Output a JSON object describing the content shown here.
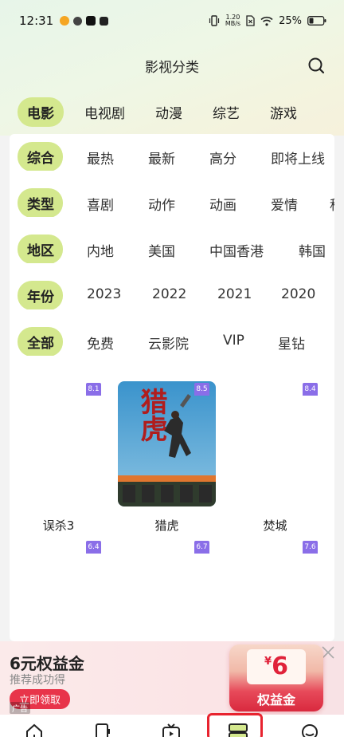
{
  "status_bar": {
    "time": "12:31",
    "net_speed_top": "1.20",
    "net_speed_bottom": "MB/s",
    "battery": "25%"
  },
  "header": {
    "title": "影视分类"
  },
  "main_tabs": [
    "电影",
    "电视剧",
    "动漫",
    "综艺",
    "游戏"
  ],
  "filters": [
    {
      "lead": "综合",
      "options": [
        "最热",
        "最新",
        "高分",
        "即将上线"
      ]
    },
    {
      "lead": "类型",
      "options": [
        "喜剧",
        "动作",
        "动画",
        "爱情",
        "科"
      ]
    },
    {
      "lead": "地区",
      "options": [
        "内地",
        "美国",
        "中国香港",
        "韩国"
      ]
    },
    {
      "lead": "年份",
      "options": [
        "2023",
        "2022",
        "2021",
        "2020"
      ]
    },
    {
      "lead": "全部",
      "options": [
        "免费",
        "云影院",
        "VIP",
        "星钻"
      ]
    }
  ],
  "movies": [
    {
      "title": "误杀3",
      "rating": "8.1"
    },
    {
      "title": "猎虎",
      "rating": "8.5",
      "poster_text": "猎虎"
    },
    {
      "title": "焚城",
      "rating": "8.4"
    },
    {
      "title": "",
      "rating": "6.4"
    },
    {
      "title": "",
      "rating": "6.7"
    },
    {
      "title": "",
      "rating": "7.6"
    }
  ],
  "ad": {
    "title": "6元权益金",
    "subtitle": "推荐成功得",
    "button": "立即领取",
    "tag": "广告",
    "promo_yen": "¥",
    "promo_value": "6",
    "promo_label": "权益金"
  },
  "colors": {
    "accent_green": "#d4e88e",
    "rating_purple": "#8a6ee8",
    "ad_red": "#e8344a",
    "highlight_red": "#e8232f"
  },
  "nav_icons": [
    "home-icon",
    "tv-icon",
    "video-icon",
    "category-icon",
    "profile-icon"
  ]
}
